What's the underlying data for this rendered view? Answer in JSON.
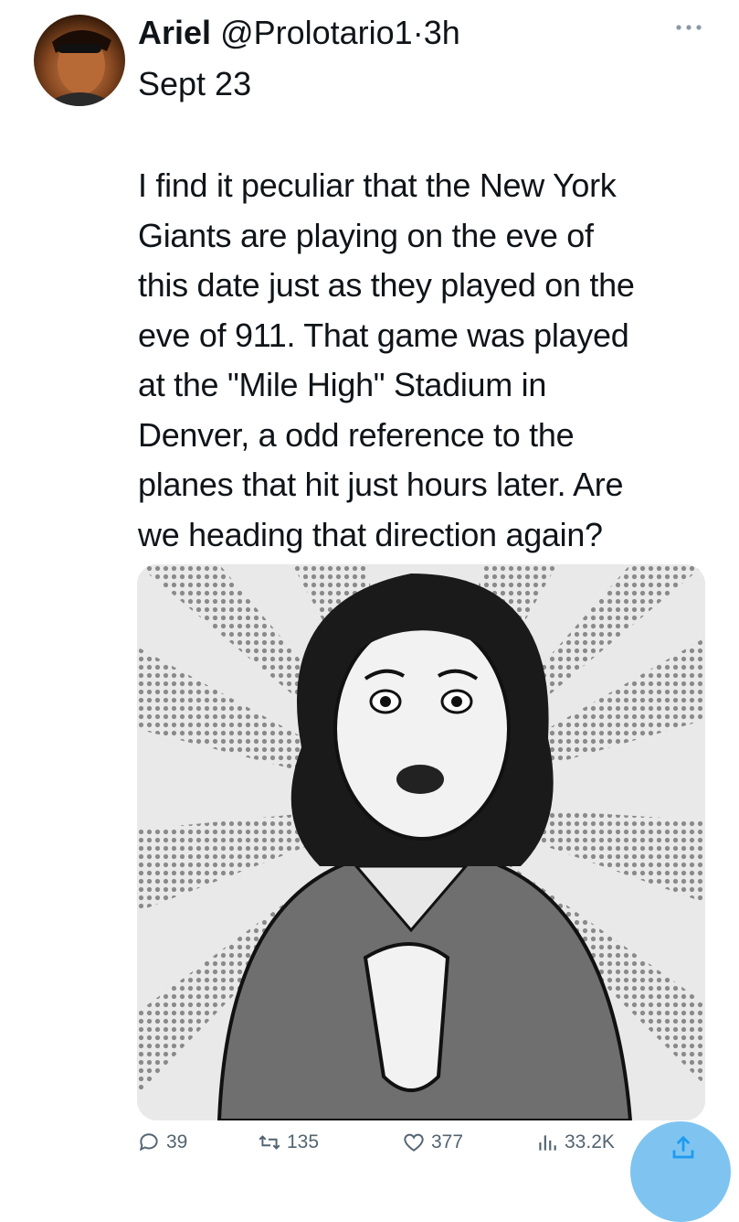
{
  "tweet": {
    "author_name": "Ariel",
    "handle": "@Prolotario1",
    "separator": "·",
    "time": "3h",
    "date_line": "Sept 23",
    "text": "I find it peculiar that the New York\nGiants are playing on the eve of\nthis date just as they played on the\neve of 911. That game was played\nat the \"Mile High\" Stadium in\nDenver, a odd reference to the\nplanes that hit just hours later. Are\nwe heading that direction again?"
  },
  "actions": {
    "replies": "39",
    "retweets": "135",
    "likes": "377",
    "views": "33.2K"
  },
  "icons": [
    "more-icon",
    "reply-icon",
    "retweet-icon",
    "like-icon",
    "views-icon",
    "share-icon"
  ]
}
